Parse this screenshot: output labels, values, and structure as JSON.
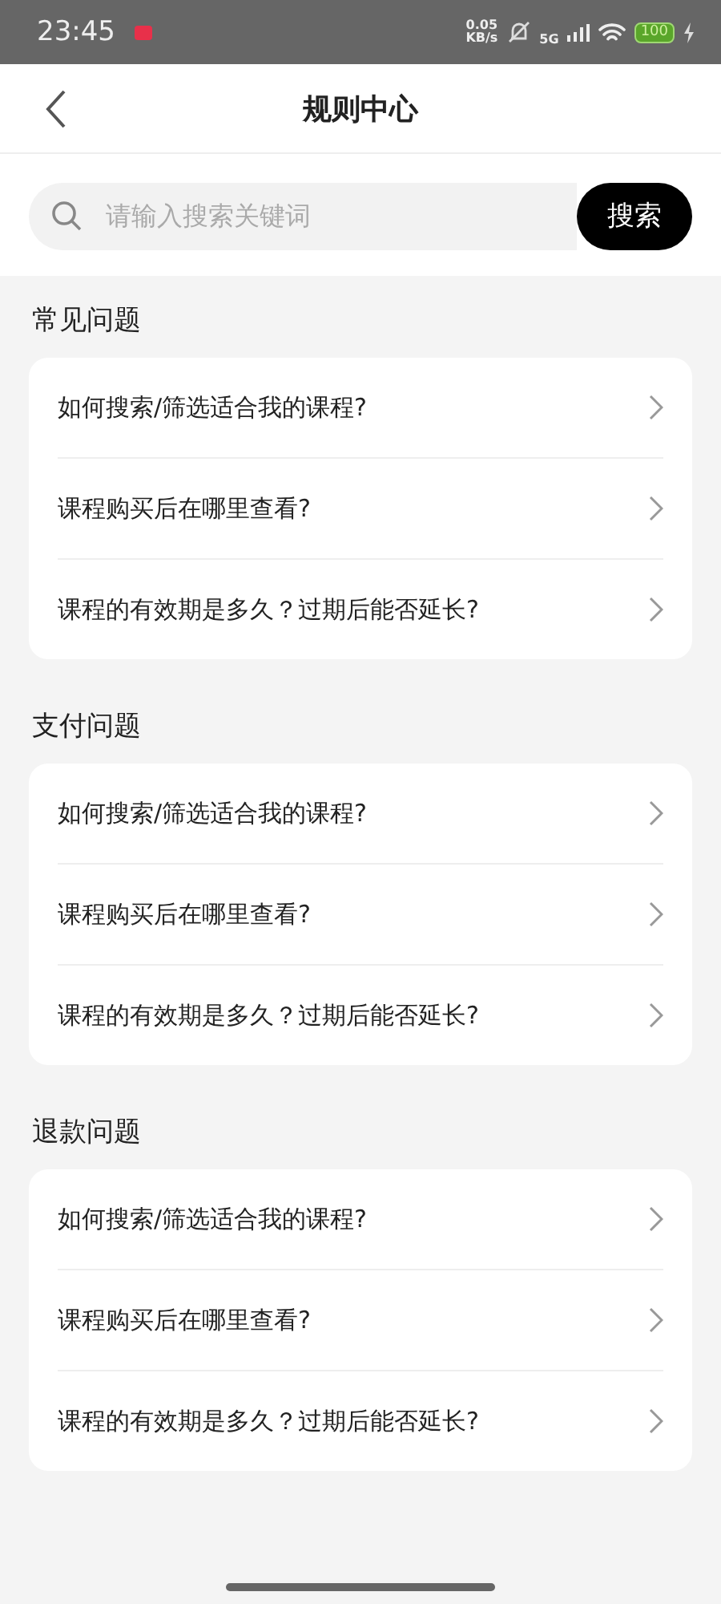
{
  "status_bar": {
    "time": "23:45",
    "net_speed": [
      "0.05",
      "KB/s"
    ],
    "network": "5G",
    "battery": "100"
  },
  "header": {
    "title": "规则中心"
  },
  "search": {
    "placeholder": "请输入搜索关键词",
    "button": "搜索"
  },
  "sections": [
    {
      "title": "常见问题",
      "items": [
        "如何搜索/筛选适合我的课程?",
        "课程购买后在哪里查看?",
        "课程的有效期是多久？过期后能否延长?"
      ]
    },
    {
      "title": "支付问题",
      "items": [
        "如何搜索/筛选适合我的课程?",
        "课程购买后在哪里查看?",
        "课程的有效期是多久？过期后能否延长?"
      ]
    },
    {
      "title": "退款问题",
      "items": [
        "如何搜索/筛选适合我的课程?",
        "课程购买后在哪里查看?",
        "课程的有效期是多久？过期后能否延长?"
      ]
    }
  ]
}
